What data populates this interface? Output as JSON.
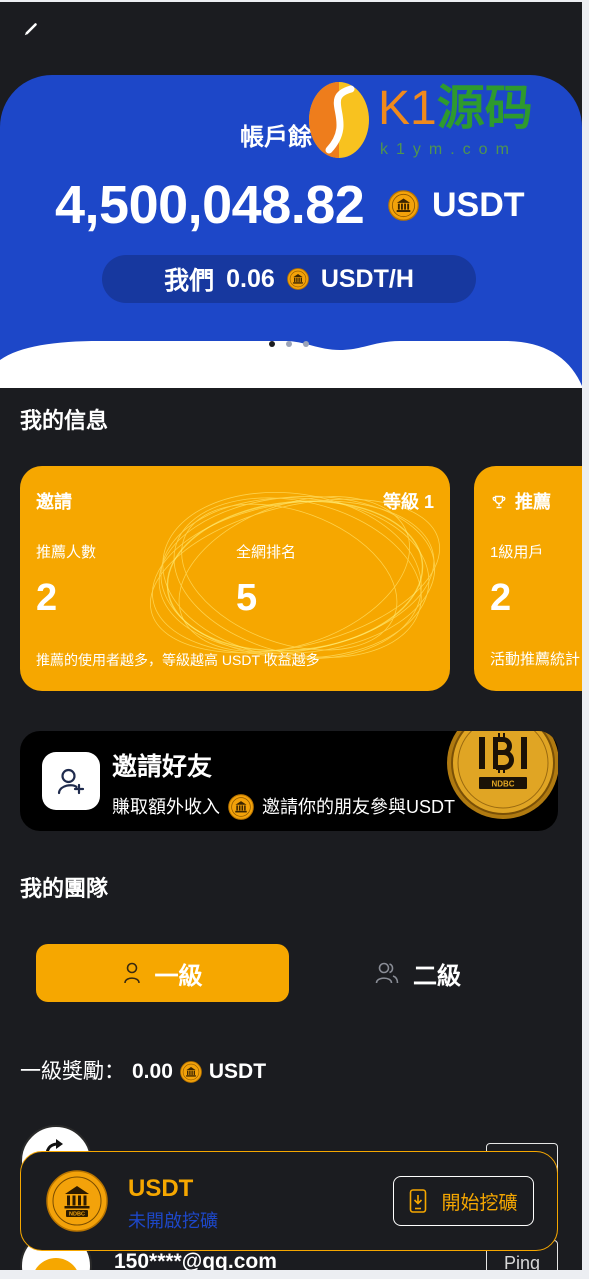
{
  "colors": {
    "background": "#1b1c20",
    "primary_blue": "#1d47c8",
    "pill_blue": "#17389f",
    "accent_orange": "#f6a700"
  },
  "header": {
    "edit_icon": "pencil-icon"
  },
  "watermark": {
    "brand_latin": "K1",
    "brand_cn": "源码",
    "domain": "k1ym.com"
  },
  "balance_card": {
    "title": "帳戶餘",
    "amount": "4,500,048.82",
    "currency": "USDT",
    "coin_icon": "bank-coin-icon",
    "rate_label": "我們",
    "rate_value": "0.06",
    "rate_unit": "USDT/H",
    "carousel": {
      "pages": 3,
      "active": 1
    }
  },
  "my_info": {
    "title": "我的信息",
    "cards": [
      {
        "title": "邀請",
        "level": "等級 1",
        "stats": [
          {
            "label": "推薦人數",
            "value": "2"
          },
          {
            "label": "全網排名",
            "value": "5"
          }
        ],
        "note": "推薦的使用者越多，等級越高 USDT 收益越多"
      },
      {
        "icon": "trophy-icon",
        "title": "推薦",
        "stats": [
          {
            "label": "1級用戶",
            "value": "2"
          }
        ],
        "note": "活動推薦統計"
      }
    ]
  },
  "invite_banner": {
    "icon": "user-plus-icon",
    "title": "邀請好友",
    "earn": "賺取額外收入",
    "desc": "邀請你的朋友參與USDT",
    "coin_label": "NDBC"
  },
  "team": {
    "title": "我的團隊",
    "tabs": [
      {
        "label": "一級",
        "icon": "person-icon",
        "active": true
      },
      {
        "label": "二級",
        "icon": "users-icon",
        "active": false
      }
    ],
    "reward_label": "一級獎勵：",
    "reward_value": "0.00",
    "reward_unit": "USDT",
    "members": [
      {
        "avatar_icon": "share-icon"
      },
      {
        "avatar_icon": "user-avatar",
        "name": "150****@qq.com",
        "action": "Ping"
      }
    ]
  },
  "mining_bar": {
    "logo_label": "NDBC",
    "coin": "USDT",
    "status": "未開啟挖礦",
    "button": "開始挖礦",
    "button_icon": "phone-download-icon"
  }
}
